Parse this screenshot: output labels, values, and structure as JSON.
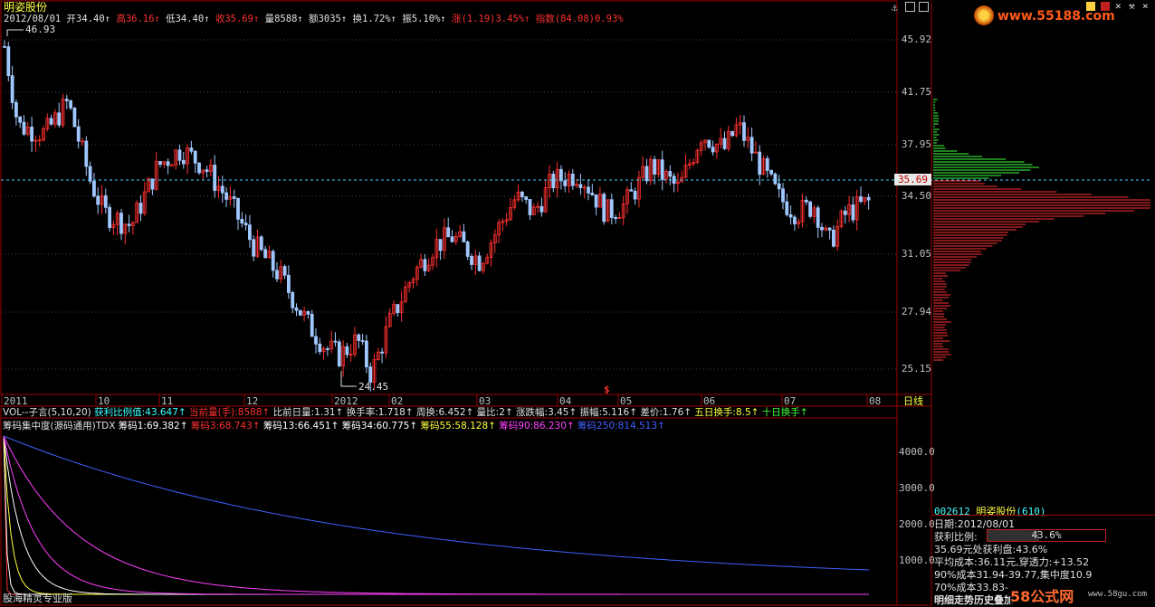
{
  "stock": {
    "name": "明姿股份",
    "code": "002612",
    "code_full": "(610)"
  },
  "header_line": {
    "date": "2012/08/01",
    "open_label": "开",
    "open": "34.40",
    "high_label": "高",
    "high": "36.16",
    "low_label": "低",
    "low": "34.40",
    "close_label": "收",
    "close": "35.69",
    "vol_label": "量",
    "vol": "8588",
    "amt_label": "额",
    "amt": "3035",
    "turn_label": "换",
    "turn": "1.72%",
    "amp_label": "振",
    "amp": "5.10%",
    "chg_label": "涨",
    "chg": "(1.19)3.45%",
    "idx_label": "指数",
    "idx": "(84.08)0.93%"
  },
  "price_axis": [
    "45.92",
    "41.75",
    "37.95",
    "34.50",
    "31.05",
    "27.94",
    "25.15"
  ],
  "current_price_tag": "35.69",
  "high_mark": "46.93",
  "low_mark": "24.45",
  "signal_mark": "$",
  "period_button": "日线",
  "time_axis": [
    "2011",
    "10",
    "11",
    "12",
    "2012",
    "02",
    "03",
    "04",
    "05",
    "06",
    "07",
    "08"
  ],
  "vol_line": {
    "title": "VOL--子言(5,10,20)",
    "items": [
      {
        "text": "获利比例值:43.647",
        "color": "#40ffff"
      },
      {
        "text": "当前量(手):8588",
        "color": "#ff3030"
      },
      {
        "text": "比前日量:1.31",
        "color": "#e0e0e0"
      },
      {
        "text": "换手率:1.718",
        "color": "#e0e0e0"
      },
      {
        "text": "周换:6.452",
        "color": "#e0e0e0"
      },
      {
        "text": "量比:2",
        "color": "#e0e0e0"
      },
      {
        "text": "涨跌幅:3.45",
        "color": "#e0e0e0"
      },
      {
        "text": "振幅:5.116",
        "color": "#e0e0e0"
      },
      {
        "text": "差价:1.76",
        "color": "#e0e0e0"
      },
      {
        "text": "五日换手:8.5",
        "color": "#ffff40"
      },
      {
        "text": "十日换手",
        "color": "#40ff40"
      }
    ]
  },
  "chip_line": {
    "title": "筹码集中度(源码通用)TDX",
    "items": [
      {
        "text": "筹码1:69.382",
        "color": "#ffffff"
      },
      {
        "text": "筹码3:68.743",
        "color": "#ff3030"
      },
      {
        "text": "筹码13:66.451",
        "color": "#ffffff"
      },
      {
        "text": "筹码34:60.775",
        "color": "#ffffff"
      },
      {
        "text": "筹码55:58.128",
        "color": "#ffff40"
      },
      {
        "text": "筹码90:86.230",
        "color": "#ff40ff"
      },
      {
        "text": "筹码250:814.513",
        "color": "#4060ff"
      }
    ]
  },
  "lower_axis": [
    "4000.0",
    "3000.0",
    "2000.0",
    "1000.0"
  ],
  "bottom_left_caption": "股海精灵专业版",
  "watermark_top": "www.55188.com",
  "watermark_bottom": "58公式网",
  "watermark_bottom_url": "www.58gu.com",
  "info_panel": {
    "header_code": "002612",
    "header_name": "明姿股份",
    "header_extra": "(610)",
    "date": "日期:2012/08/01",
    "profit_label": "获利比例:",
    "profit_value": "43.6%",
    "profit_fraction": 0.436,
    "line1": "35.69元处获利盘:43.6%",
    "line2": "平均成本:36.11元,穿透力:+13.52",
    "line3": "90%成本31.94-39.77,集中度10.9",
    "line4": "70%成本33.83-",
    "line5": "明细走势历史叠加"
  },
  "colors": {
    "up": "#ff3030",
    "down": "#a0c8ff",
    "grid": "#505050"
  }
}
